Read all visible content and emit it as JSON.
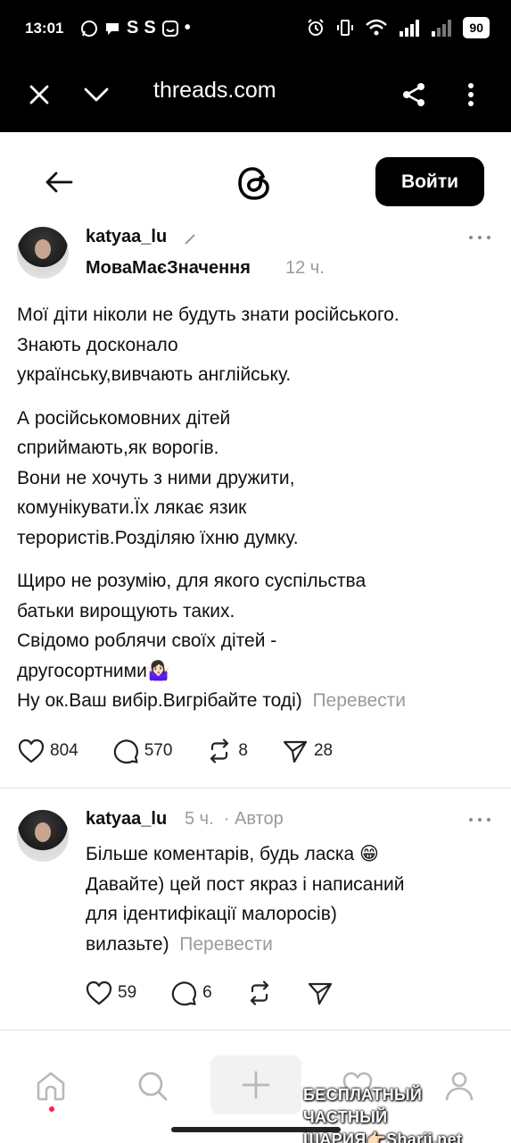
{
  "status_bar": {
    "time": "13:01",
    "left_icons": [
      "whatsapp-icon",
      "chat-bubble-icon",
      "S",
      "S",
      "smile-app-icon",
      "•"
    ],
    "right_icons": [
      "alarm-icon",
      "vibrate-icon",
      "wifi-icon",
      "signal-icon",
      "signal-icon"
    ],
    "battery": "90"
  },
  "browser": {
    "url": "threads.com"
  },
  "header": {
    "login_label": "Войти"
  },
  "post": {
    "username": "katyaa_lu",
    "topic": "МоваМаєЗначення",
    "time": "12 ч.",
    "paragraphs": [
      [
        "Мої діти ніколи не будуть знати російського.",
        "Знають досконало",
        "українську,вивчають англійську."
      ],
      [
        "А російськомовних дітей",
        "сприймають,як ворогів.",
        "Вони не хочуть з ними дружити,",
        "комунікувати.Їх лякає язик",
        "терористів.Розділяю їхню думку."
      ],
      [
        "Щиро не розумію, для якого суспільства",
        "батьки вирощують таких.",
        "Свідомо роблячи своїх дітей -",
        "другосортними🤷🏻‍♀️",
        "Ну ок.Ваш вибір.Вигрібайте тоді)"
      ]
    ],
    "translate": "Перевести",
    "likes": "804",
    "replies": "570",
    "reposts": "8",
    "shares": "28"
  },
  "reply": {
    "username": "katyaa_lu",
    "time": "5 ч.",
    "badge": "Автор",
    "lines": [
      "Більше коментарів, будь ласка 😁",
      "Давайте) цей пост якраз і написаний",
      "для ідентифікації малоросів)",
      "вилазьте)"
    ],
    "translate": "Перевести",
    "likes": "59",
    "replies": "6"
  },
  "watermark": {
    "line1": "БЕСПЛАТНЫЙ ЧАСТНЫЙ",
    "line2": "ШАРИЯ👉🏻Sharij.net"
  },
  "colors": {
    "text": "#101010",
    "muted": "#9a9a9a",
    "accent_dot": "#ff1e4d",
    "button_bg": "#000000"
  }
}
